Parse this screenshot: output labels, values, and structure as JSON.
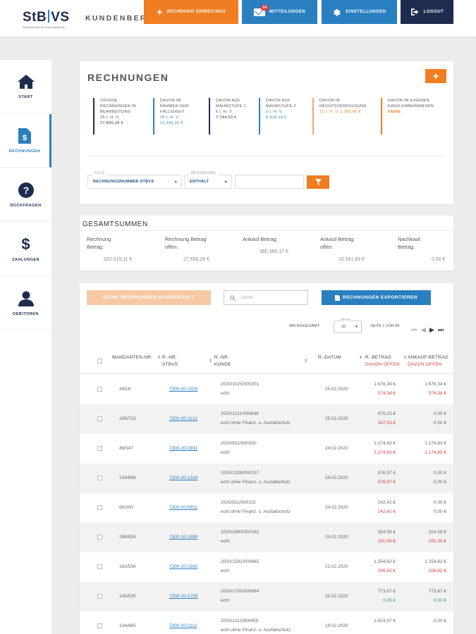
{
  "header": {
    "logo": "StB|VS",
    "logo_left": "StB",
    "logo_right": "VS",
    "logo_sub": "Steuerberater Verrechnungsstelle",
    "portal_title": "KUNDENBEREICH",
    "buttons": {
      "invoice": "Rechnung einreichen",
      "messages": "Mitteilungen",
      "messages_badge": "56",
      "settings": "Einstellungen",
      "logout": "Logout"
    }
  },
  "sidebar": {
    "items": [
      {
        "label": "START",
        "icon": "home-icon"
      },
      {
        "label": "RECHNUNGEN",
        "icon": "invoice-icon"
      },
      {
        "label": "RÜCKFRAGEN",
        "icon": "question-icon"
      },
      {
        "label": "ZAHLUNGEN",
        "icon": "dollar-icon"
      },
      {
        "label": "DEBITOREN",
        "icon": "user-icon"
      }
    ]
  },
  "invoices_panel": {
    "title": "RECHNUNGEN",
    "add_label": "+",
    "stats": [
      {
        "line1": "OFFENE",
        "line2": "RECHNUNGEN IN",
        "line3": "BEARBEITUNG",
        "v1": "35 i. H. v.",
        "v2": "27.606,28 €"
      },
      {
        "line1": "DAVON IM",
        "line2": "RAHMEN DER",
        "line3": "FÄLLIGKEIT",
        "v1": "35 i. H. v.",
        "v2": "12.142,01 €"
      },
      {
        "line1": "DAVON AUF",
        "line2": "MAHNSTUFE 1",
        "line3": "",
        "v1": "6 i. H. v.",
        "v2": "7.744,53 €"
      },
      {
        "line1": "DAVON AUF",
        "line2": "MAHNSTUFE 2",
        "line3": "",
        "v1": "5 i. H. v.",
        "v2": "6.414,19 €"
      },
      {
        "line1": "DAVON IN",
        "line2": "RECHTSVERFOLGUNG",
        "line3": "",
        "v1": "21 i. H. v. 1.305,45 €",
        "v2": ""
      },
      {
        "line1": "DAVON IM EIGENEN",
        "line2": "KANZLEIMAHNWESEN",
        "line3": "",
        "v1": "KEINE",
        "v2": ""
      }
    ],
    "filter": {
      "field_label": "FELD",
      "field_value": "RECHNUNGSNUMMER STBVS",
      "condition_label": "BEDINGUNG",
      "condition_value": "ENTHÄLT",
      "search_value": ""
    }
  },
  "totals": {
    "title": "GESAMTSUMMEN",
    "items": [
      {
        "label1": "Rechnung",
        "label2": "Betrag:",
        "value": "932.015,11 €"
      },
      {
        "label1": "Rechnung Betrag",
        "label2": "offen:",
        "value": "27.606,28 €"
      },
      {
        "label1": "Ankauf Betrag:",
        "label2": "",
        "value": "380.366,17 €"
      },
      {
        "label1": "Ankauf Betrag",
        "label2": "offen:",
        "value": "10.581,69 €"
      },
      {
        "label1": "Nachkauf",
        "label2": "Betrag:",
        "value": "0,00 €"
      }
    ]
  },
  "table": {
    "none_selected": "KEINE RECHNUNGEN AUSGEWÄHLT",
    "search_placeholder": "Suche",
    "export": "RECHNUNGEN EXPORTIEREN",
    "total_text": "989 INSGESAMT",
    "perpage_label": "ZEIGE",
    "perpage_value": "10",
    "page_text": "SEITE 1 VON 89",
    "headers": {
      "mandant": "MANDANTEN-NR.",
      "rnr_stbvs_1": "R.-NR.",
      "rnr_stbvs_2": "STBVS",
      "rnr_kunde_1": "R.-NR.",
      "rnr_kunde_2": "KUNDE",
      "datum": "R.-DATUM",
      "betrag_1": "R.-BETRAG",
      "betrag_2": "DAVON OFFEN",
      "ankauf_1": "ANKAUF-BETRAG",
      "ankauf_2": "DAVON OFFEN"
    },
    "rows": [
      {
        "mandant": "4/616",
        "stbvs": "7300-20-1025",
        "kunde1": "2020/1025/000201",
        "kunde2": "echt",
        "datum": "25.02.2020",
        "betrag": "1.678,34 €",
        "betrag_offen": "574,34 €",
        "offen_color": "red",
        "ankauf": "1.678,34 €",
        "ankauf_offen": "574,34 €",
        "ankauf_color": "red"
      },
      {
        "mandant": "199/723",
        "stbvs": "7300-20-1131",
        "kunde1": "2020/1131/000648",
        "kunde2": "echt ohne Finanz. u. Ausfallschutz",
        "datum": "25.02.2020",
        "betrag": "678,23 €",
        "betrag_offen": "247,23 €",
        "offen_color": "red",
        "ankauf": "0,00 €",
        "ankauf_offen": "0,00 €",
        "ankauf_color": "grey"
      },
      {
        "mandant": "48/547",
        "stbvs": "7300-20-0931",
        "kunde1": "2020/931/000250",
        "kunde2": "echt",
        "datum": "24.02.2020",
        "betrag": "1.174,83 €",
        "betrag_offen": "1.174,83 €",
        "offen_color": "red",
        "ankauf": "1.174,83 €",
        "ankauf_offen": "1.174,83 €",
        "ankauf_color": "red"
      },
      {
        "mandant": "134/868",
        "stbvs": "7300-20-1328",
        "kunde1": "2020/1328/000137",
        "kunde2": "echt ohne Finanz. u. Ausfallschutz",
        "datum": "24.02.2020",
        "betrag": "576,97 €",
        "betrag_offen": "576,97 €",
        "offen_color": "red",
        "ankauf": "0,00 €",
        "ankauf_offen": "0,00 €",
        "ankauf_color": "grey"
      },
      {
        "mandant": "66/300",
        "stbvs": "7300-20-0911",
        "kunde1": "2020/911/000115",
        "kunde2": "echt ohne Finanz. u. Ausfallschutz",
        "datum": "24.02.2020",
        "betrag": "142,41 €",
        "betrag_offen": "142,41 €",
        "offen_color": "red",
        "ankauf": "0,00 €",
        "ankauf_offen": "0,00 €",
        "ankauf_color": "grey"
      },
      {
        "mandant": "188/826",
        "stbvs": "7300-20-1890",
        "kunde1": "2020/1890/000192",
        "kunde2": "echt",
        "datum": "23.02.2020",
        "betrag": "324,59 €",
        "betrag_offen": "191,59 €",
        "offen_color": "red",
        "ankauf": "324,59 €",
        "ankauf_offen": "191,59 €",
        "ankauf_color": "red"
      },
      {
        "mandant": "182/556",
        "stbvs": "7300-20-1592",
        "kunde1": "2020/1592/000665",
        "kunde2": "echt",
        "datum": "21.02.2020",
        "betrag": "1.254,62 €",
        "betrag_offen": "206,62 €",
        "offen_color": "red",
        "ankauf": "1.254,62 €",
        "ankauf_offen": "206,62 €",
        "ankauf_color": "red"
      },
      {
        "mandant": "145/520",
        "stbvs": "7300-20-1705",
        "kunde1": "2020/1705/000894",
        "kunde2": "echt",
        "datum": "20.02.2020",
        "betrag": "773,67 €",
        "betrag_offen": "0,00 €",
        "offen_color": "green",
        "ankauf": "773,67 €",
        "ankauf_offen": "0,00 €",
        "ankauf_color": "green"
      },
      {
        "mandant": "134/885",
        "stbvs": "7300-20-1112",
        "kunde1": "2020/1112/000459",
        "kunde2": "echt ohne Finanz. u. Ausfallschutz",
        "datum": "19.02.2020",
        "betrag": "1.624,97 €",
        "betrag_offen": "",
        "offen_color": "red",
        "ankauf": "0,00 €",
        "ankauf_offen": "",
        "ankauf_color": "grey"
      }
    ]
  },
  "colors": {
    "orange": "#f07d22",
    "blue": "#2a7fc0",
    "navy": "#1e2d4f",
    "red": "#e03a3a",
    "green": "#2aa745"
  }
}
